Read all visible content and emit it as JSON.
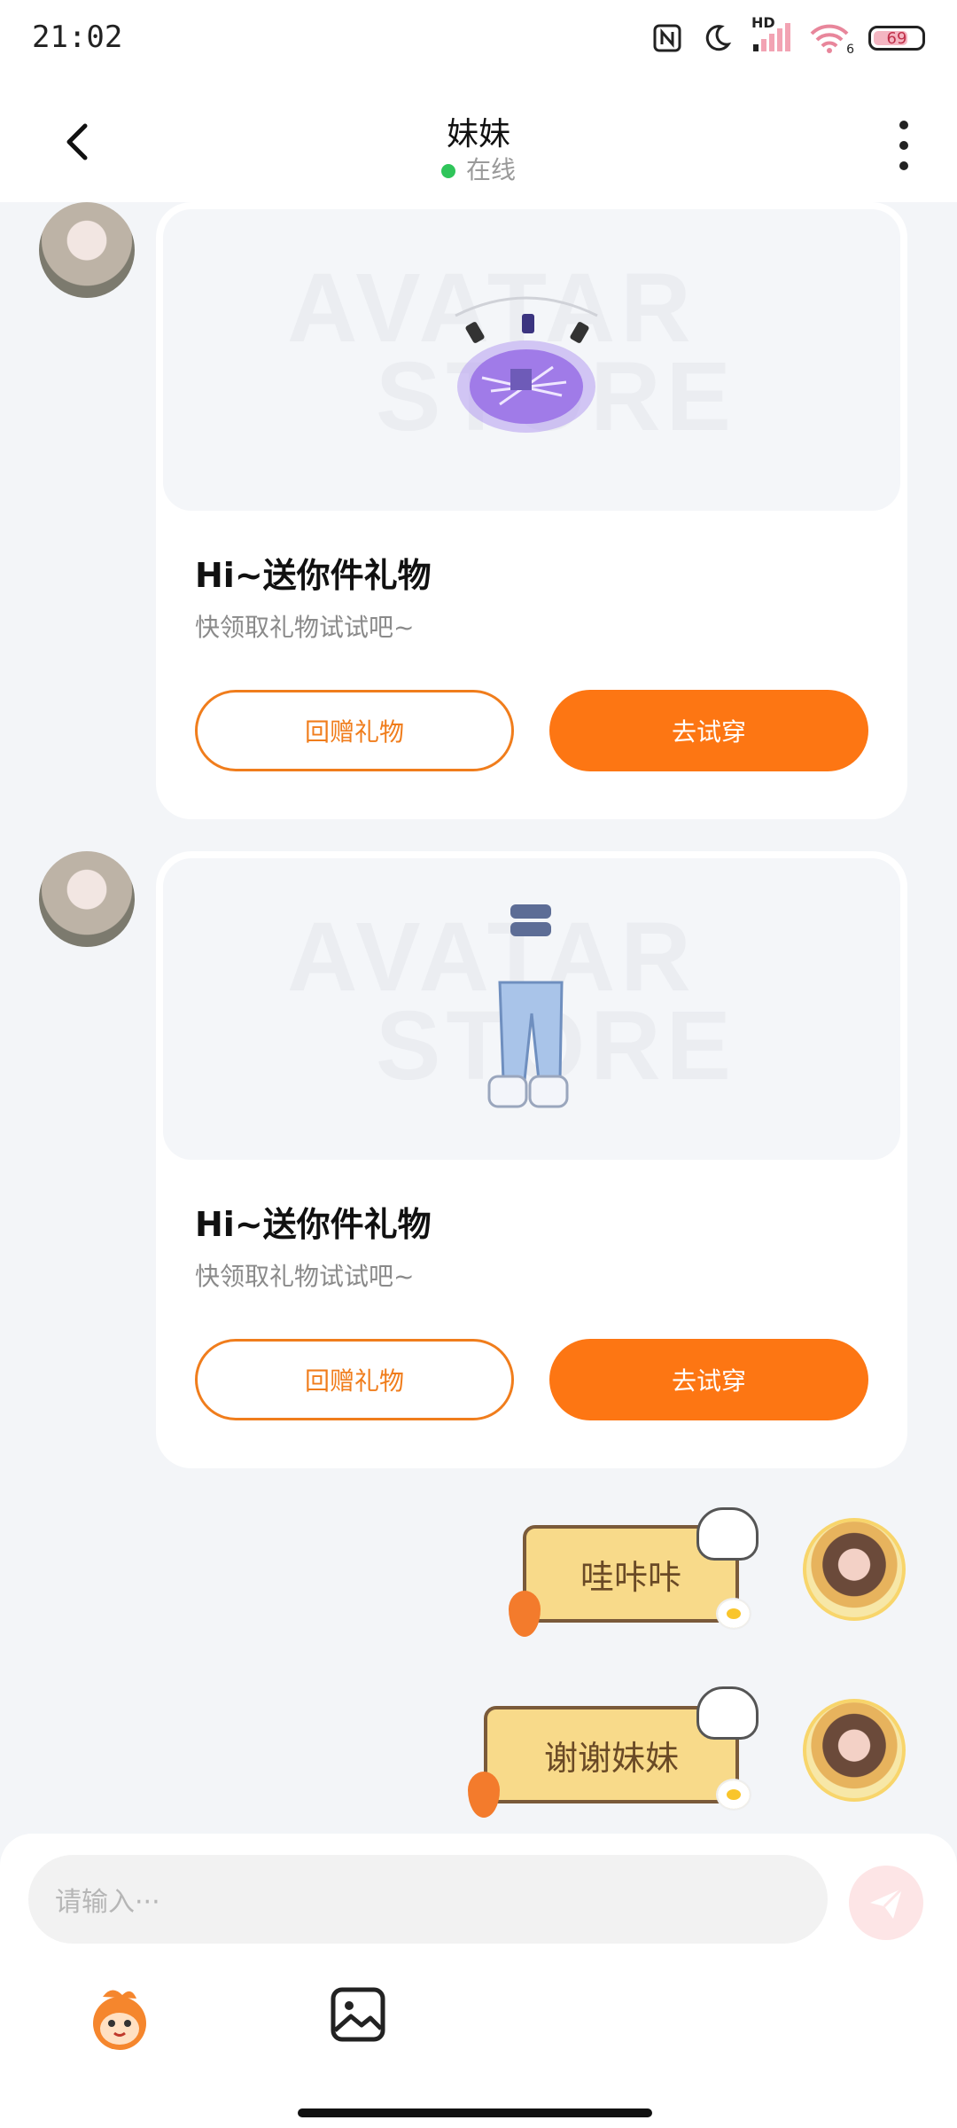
{
  "status_bar": {
    "time": "21:02",
    "network_label": "HD",
    "wifi_label": "6",
    "battery": "69"
  },
  "header": {
    "title": "妹妹",
    "status": "在线"
  },
  "gift_cards": [
    {
      "watermark_top": "AVATAR",
      "watermark_bottom": "STORE",
      "title": "Hi~送你件礼物",
      "subtitle": "快领取礼物试试吧~",
      "return_gift_label": "回赠礼物",
      "try_on_label": "去试穿"
    },
    {
      "watermark_top": "AVATAR",
      "watermark_bottom": "STORE",
      "title": "Hi~送你件礼物",
      "subtitle": "快领取礼物试试吧~",
      "return_gift_label": "回赠礼物",
      "try_on_label": "去试穿"
    }
  ],
  "my_messages": [
    {
      "text": "哇咔咔"
    },
    {
      "text": "谢谢妹妹"
    }
  ],
  "composer": {
    "placeholder": "请输入···"
  },
  "colors": {
    "accent": "#fd7613",
    "online": "#2fc55a",
    "background": "#f3f5f8",
    "bubble": "#f8da8a"
  },
  "icons": [
    "back-icon",
    "more-icon",
    "send-icon",
    "emoji-sticker-icon",
    "image-icon"
  ]
}
